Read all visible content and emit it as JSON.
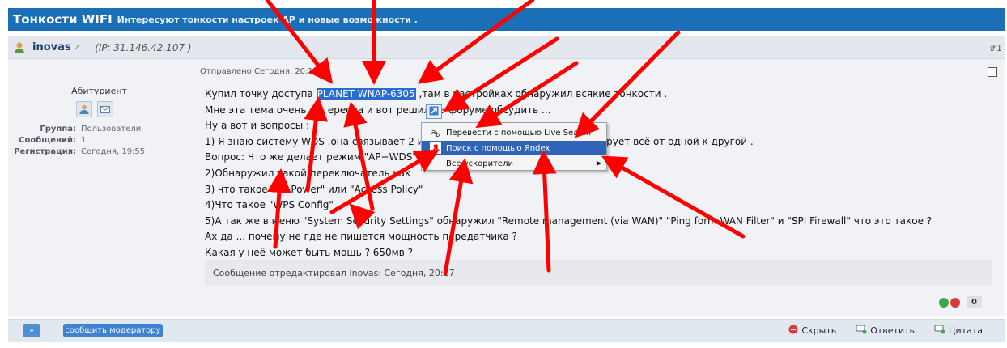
{
  "forum": {
    "title": "Тонкости WIFI",
    "description": "Интересуют тонкости настроек АР и новые возможности ."
  },
  "user": {
    "name": "inovas",
    "ip": "(IP: 31.146.42.107 )",
    "post_number": "#1",
    "rank": "Абитуриент",
    "stats": [
      {
        "label": "Группа:",
        "value": "Пользователи"
      },
      {
        "label": "Сообщений:",
        "value": "1"
      },
      {
        "label": "Регистрация:",
        "value": "Сегодня, 19:55"
      }
    ]
  },
  "post": {
    "sent": "Отправлено Сегодня, 20:1",
    "line1_before": "Купил точку доступа ",
    "line1_highlight": "PLANET WNAP-6305",
    "line1_after": " ,там в настройках обнаружил всякие тонкости .",
    "lines": [
      "Мне эта тема очень интересна и вот решил на форуме обсудить ...",
      "Ну а вот и вопросы :",
      "1) Я знаю систему WDS ,она связывает 2 и более точек доступа и синхронизирует всё от одной к другой .",
      "Вопрос: Что же делает режим \"AP+WDS\"",
      "2)Обнаружил такой переключатель как",
      "3) что такое \"TX Power\" или \"Access Policy\"",
      "4)Что такое \"WPS Config\"",
      "5)А так же в меню \"System Security Settings\" обнаружил \"Remote management (via WAN)\" \"Ping form WAN Filter\" и \"SPI Firewall\" что это такое ?",
      "Ах да ... почему не где не пишется мощность передатчика ?",
      "Какая у неё может быть мощь ? 650мв ?"
    ],
    "edited": "Сообщение отредактировал inovas: Сегодня, 20:17",
    "rating": "0"
  },
  "context_menu": {
    "items": [
      {
        "label": "Перевести с помощью Live Search",
        "icon": "translate-icon"
      },
      {
        "label": "Поиск с помощью Яndex",
        "icon": "yandex-icon"
      },
      {
        "label": "Все ускорители",
        "icon": "none"
      }
    ]
  },
  "actions": {
    "up": "»",
    "report": "сообщить модератору",
    "hide": "Скрыть",
    "reply": "Ответить",
    "quote": "Цитата"
  },
  "colors": {
    "header": "#1b6fb6",
    "menu_selected": "#3064b8",
    "arrow": "#ff0000"
  }
}
